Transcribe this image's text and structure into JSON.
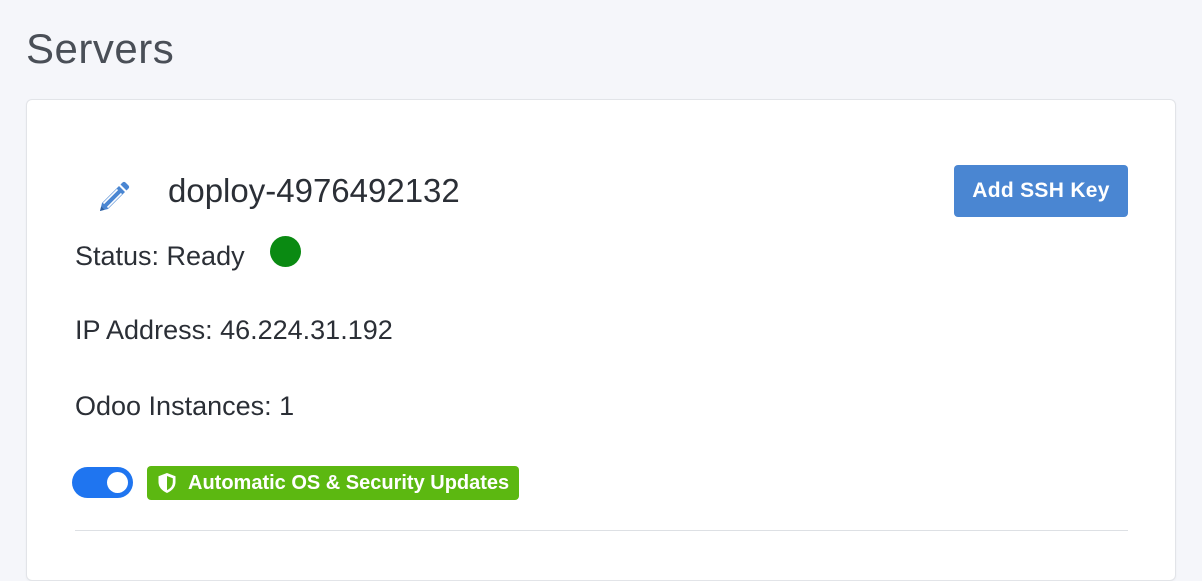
{
  "page": {
    "title": "Servers"
  },
  "server": {
    "name": "doploy-4976492132",
    "add_ssh_key_label": "Add SSH Key",
    "status_text": "Status: Ready",
    "status_color": "#0a8a12",
    "ip_text": "IP Address: 46.224.31.192",
    "instances_text": "Odoo Instances: 1",
    "auto_updates": {
      "enabled": true,
      "badge_label": "Automatic OS & Security Updates",
      "badge_color": "#5cb811",
      "toggle_color": "#1f75f0"
    }
  },
  "icons": {
    "edit": "pencil-icon",
    "shield": "shield-icon"
  },
  "colors": {
    "primary_button": "#4a86d2",
    "page_background": "#f5f6fa"
  }
}
